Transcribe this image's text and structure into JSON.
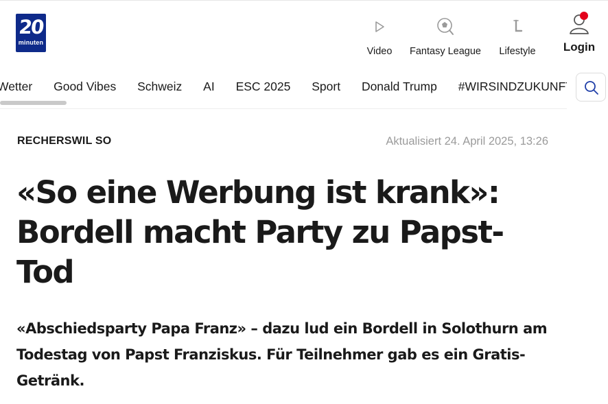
{
  "header": {
    "logo": {
      "number": "20",
      "word": "minuten"
    },
    "nav": [
      {
        "label": "Video",
        "icon": "play-icon"
      },
      {
        "label": "Fantasy League",
        "icon": "soccer-ball-icon"
      },
      {
        "label": "Lifestyle",
        "icon": "lifestyle-icon"
      }
    ],
    "login": {
      "label": "Login",
      "icon": "user-icon",
      "notification": true
    }
  },
  "topics": {
    "items": [
      "Wetter",
      "Good Vibes",
      "Schweiz",
      "AI",
      "ESC 2025",
      "Sport",
      "Donald Trump",
      "#WIRSINDZUKUNFT"
    ],
    "search_icon": "search-icon"
  },
  "article": {
    "location": "RECHERSWIL SO",
    "updated": "Aktualisiert 24. April 2025, 13:26",
    "headline": "«So eine Werbung ist krank»: Bordell macht Party zu Papst-Tod",
    "lead": "«Abschiedsparty Papa Franz» – dazu lud ein Bordell in Solothurn am Todestag von Papst Franziskus. Für Teilnehmer gab es ein Gratis-Getränk."
  },
  "colors": {
    "brand": "#0e2a8a",
    "notification": "#e3001b",
    "muted_text": "#9b9b9b"
  }
}
